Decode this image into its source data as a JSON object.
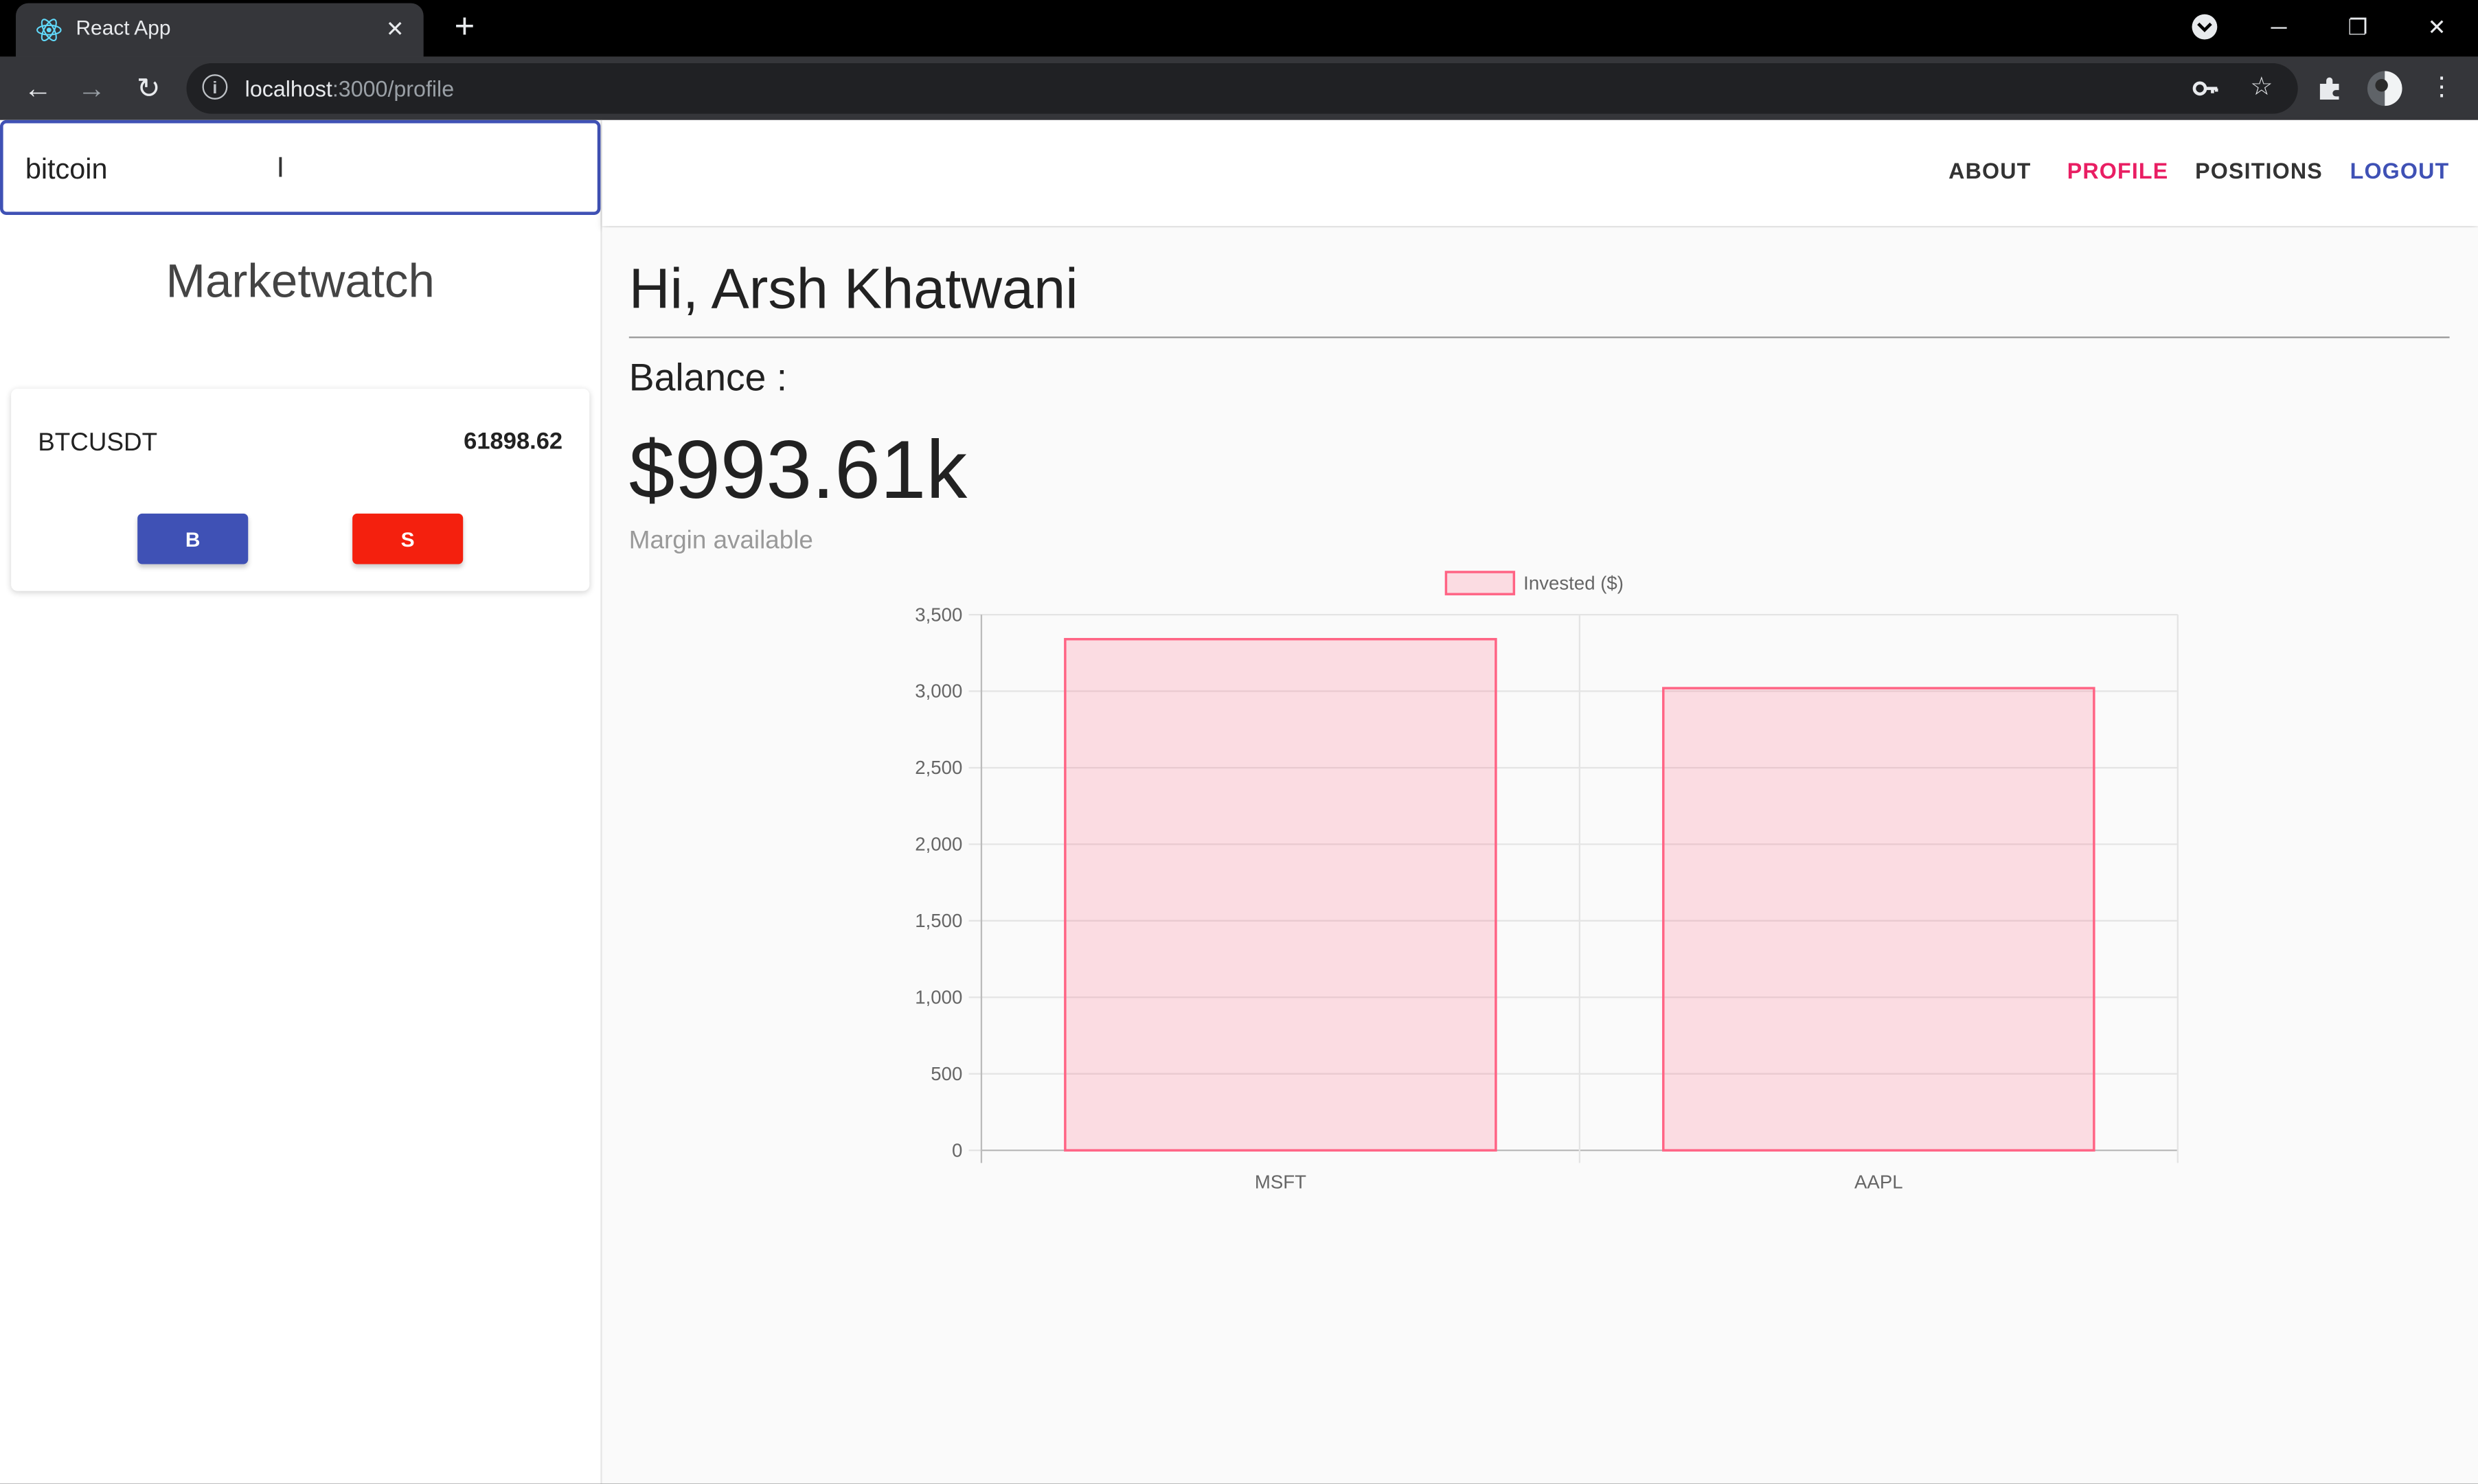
{
  "browser": {
    "tab_title": "React App",
    "url_host": "localhost",
    "url_path": ":3000/profile"
  },
  "search": {
    "value": "bitcoin"
  },
  "marketwatch": {
    "title": "Marketwatch",
    "items": [
      {
        "symbol": "BTCUSDT",
        "price": "61898.62",
        "buy_label": "B",
        "sell_label": "S"
      }
    ]
  },
  "nav": {
    "about": "ABOUT",
    "profile": "PROFILE",
    "positions": "POSITIONS",
    "logout": "LOGOUT"
  },
  "colors": {
    "primary": "#3f51b5",
    "active_nav": "#e91e63",
    "sell": "#f4200e",
    "bar_fill": "rgba(255,99,132,0.2)",
    "bar_border": "rgb(255,99,132)"
  },
  "profile": {
    "greeting": "Hi, Arsh Khatwani",
    "balance_label": "Balance :",
    "balance_value": "$993.61k",
    "margin_label": "Margin available"
  },
  "chart_data": {
    "type": "bar",
    "categories": [
      "MSFT",
      "AAPL"
    ],
    "series": [
      {
        "name": "Invested ($)",
        "values": [
          3340,
          3020
        ]
      }
    ],
    "yticks": [
      "0",
      "500",
      "1,000",
      "1,500",
      "2,000",
      "2,500",
      "3,000",
      "3,500"
    ],
    "ylim": [
      0,
      3500
    ],
    "legend": "top",
    "grid": true
  }
}
